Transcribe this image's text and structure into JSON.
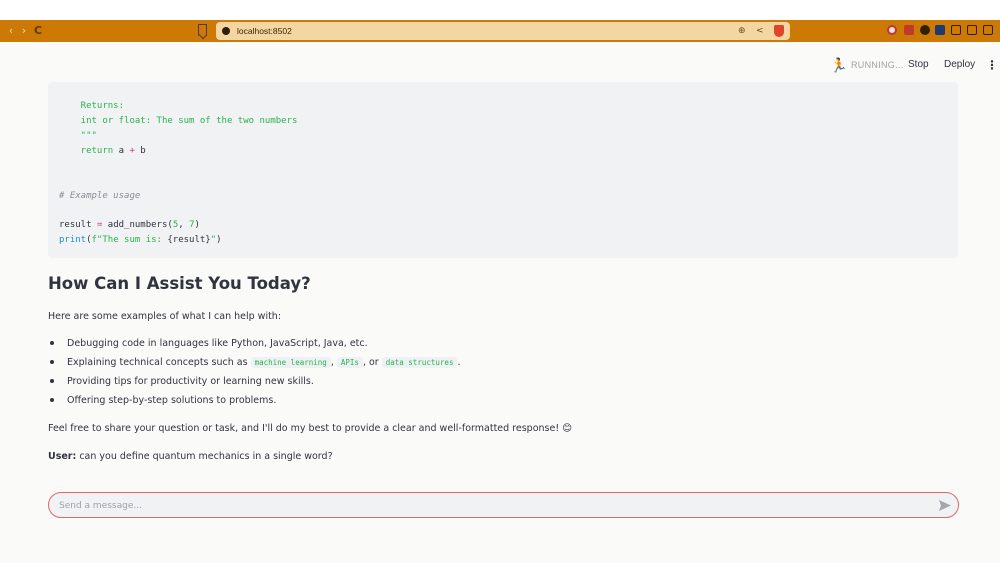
{
  "browser": {
    "url": "localhost:8502",
    "nav_back": "‹",
    "nav_forward": "›",
    "nav_reload": "C",
    "accent": "#cc7a05"
  },
  "toolbar": {
    "status": "RUNNING...",
    "stop_label": "Stop",
    "deploy_label": "Deploy"
  },
  "code": {
    "lines": [
      "    Returns:",
      "    int or float: The sum of the two numbers",
      "    \"\"\"",
      "    return a + b",
      "# Example usage",
      "result = add_numbers(5, 7)",
      "print(f\"The sum is: {result}\")"
    ]
  },
  "content": {
    "heading": "How Can I Assist You Today?",
    "intro": "Here are some examples of what I can help with:",
    "bullets": [
      "Debugging code in languages like Python, JavaScript, Java, etc.",
      "Explaining technical concepts such as",
      "Providing tips for productivity or learning new skills.",
      "Offering step-by-step solutions to problems."
    ],
    "bullet2_codes": [
      "machine learning",
      "APIs",
      "data structures"
    ],
    "bullet2_sep1": ",",
    "bullet2_sep2": ", or",
    "bullet2_end": ".",
    "closing": "Feel free to share your question or task, and I'll do my best to provide a clear and well-formatted response! 😊",
    "user_label": "User:",
    "user_message": "can you define quantum mechanics in a single word?"
  },
  "chat": {
    "placeholder": "Send a message..."
  }
}
